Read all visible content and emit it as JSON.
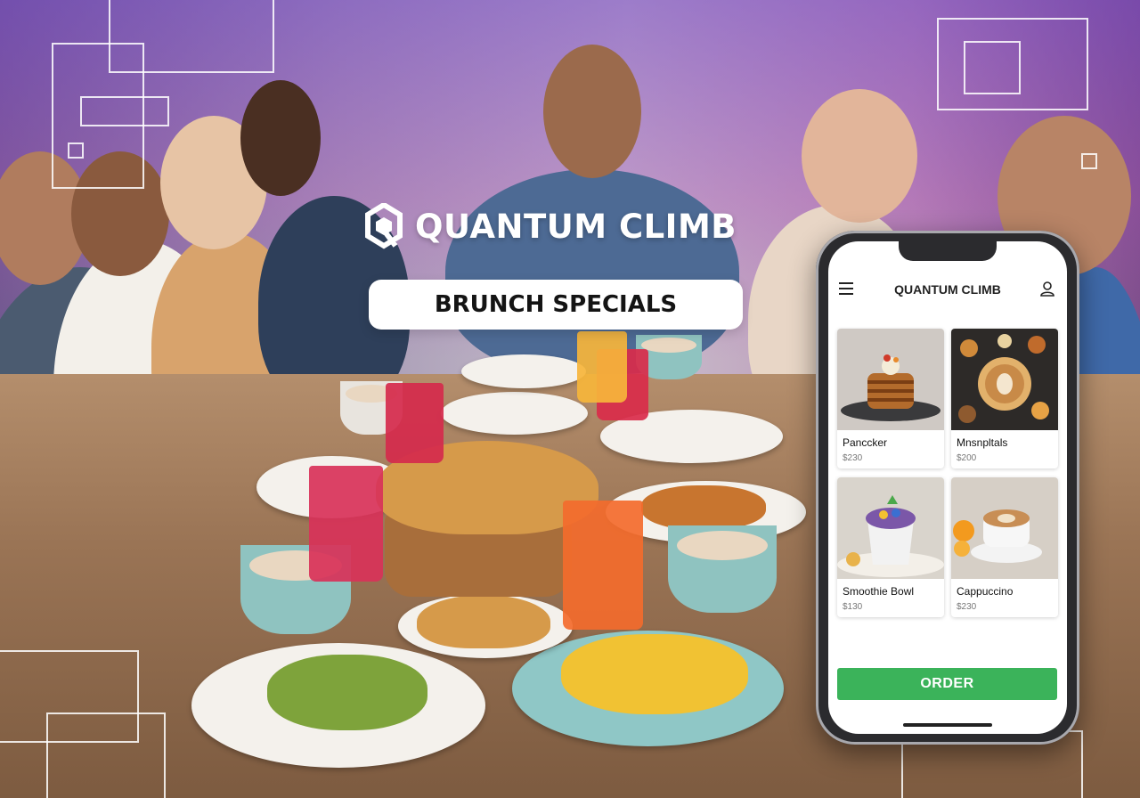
{
  "brand": {
    "name": "QUANTUM CLIMB",
    "logo_icon": "q-logo-icon",
    "banner": "BRUNCH SPECIALS"
  },
  "app": {
    "title": "QUANTUM CLIMB",
    "menu_icon": "hamburger-menu-icon",
    "profile_icon": "user-profile-icon",
    "products": [
      {
        "name": "Panccker",
        "price": "$230"
      },
      {
        "name": "Mnsnpltals",
        "price": "$200"
      },
      {
        "name": "Smoothie Bowl",
        "price": "$130"
      },
      {
        "name": "Cappuccino",
        "price": "$230"
      }
    ],
    "order_label": "ORDER"
  },
  "colors": {
    "order_button": "#3bb35a",
    "banner_bg": "#ffffff",
    "accent_purple": "#8a4fd1"
  }
}
